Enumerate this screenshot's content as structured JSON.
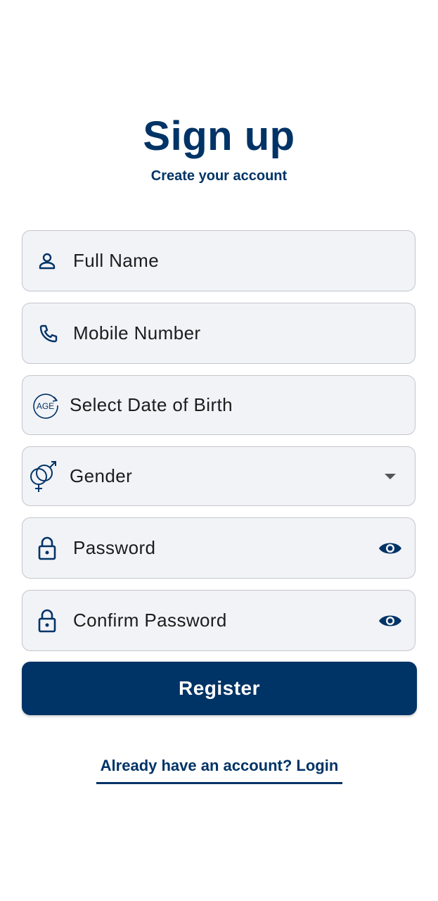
{
  "header": {
    "title": "Sign up",
    "subtitle": "Create your account"
  },
  "form": {
    "full_name": {
      "placeholder": "Full Name",
      "icon": "person-icon"
    },
    "mobile": {
      "placeholder": "Mobile Number",
      "icon": "phone-icon"
    },
    "dob": {
      "placeholder": "Select Date of Birth",
      "icon": "age-icon",
      "icon_text": "AGE"
    },
    "gender": {
      "placeholder": "Gender",
      "icon": "gender-icon",
      "trail_icon": "dropdown-arrow-icon"
    },
    "password": {
      "placeholder": "Password",
      "icon": "lock-icon",
      "trail_icon": "eye-icon"
    },
    "confirm_password": {
      "placeholder": "Confirm Password",
      "icon": "lock-icon",
      "trail_icon": "eye-icon"
    }
  },
  "actions": {
    "register_label": "Register",
    "login_link": "Already have an account? Login"
  },
  "colors": {
    "primary": "#003366",
    "field_bg": "#f2f3f7",
    "field_border": "#c4c6cc"
  }
}
